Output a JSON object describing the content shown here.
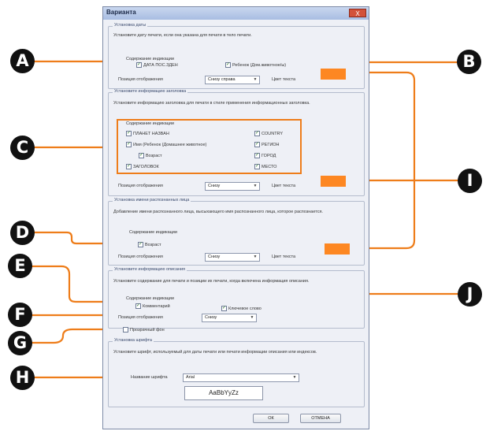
{
  "dialog": {
    "title": "Вариантa",
    "close_label": "X",
    "date_group": {
      "title": "Установка даты",
      "description": "Установите дату печати, если она указана для печати в тело печати.",
      "section_label": "Содержание индикации",
      "date_checkbox": "ДАТА ПОС.ЗДЕН",
      "date_checked": true,
      "baby_checkbox": "Ребенок (Дом.животное/ы)",
      "baby_checked": true,
      "position_label": "Позиция отображения",
      "position_value": "Снизу справа",
      "color_label": "Цвет текста"
    },
    "header_group": {
      "title": "Установите информацию заголовка",
      "description": "Установите информацию заголовка для печати в стиле применения информационных заголовка.",
      "section_label": "Содержание индикации",
      "items_left": [
        {
          "label": "ПЛАНЕТ НАЗВАН",
          "checked": true
        },
        {
          "label": "Имя (Ребенок (Домашнее животное)",
          "checked": true
        },
        {
          "label": "Возраст",
          "checked": true
        },
        {
          "label": "ЗАГОЛОВОК",
          "checked": true
        }
      ],
      "items_right": [
        {
          "label": "COUNTRY",
          "checked": true
        },
        {
          "label": "РЕГИОН",
          "checked": true
        },
        {
          "label": "ГОРОД",
          "checked": true
        },
        {
          "label": "МЕСТО",
          "checked": true
        }
      ],
      "position_label": "Позиция отображения",
      "position_value": "Снизу",
      "color_label": "Цвет текста"
    },
    "face_group": {
      "title": "Установка имени распознанных лица",
      "description": "Добавление имени распознанного лица, высыхающего имя распознанного лица, которое распознается.",
      "section_label": "Содержание индикации",
      "age_checkbox": "Возраст",
      "age_checked": true,
      "position_label": "Позиция отображения",
      "position_value": "Снизу",
      "color_label": "Цвет текста"
    },
    "caption_group": {
      "title": "Установите информацию описания",
      "description": "Установите содержание для печати и позиции их печати, когда включена информация описания.",
      "section_label": "Содержание индикации",
      "comment_checkbox": "Комментарий",
      "comment_checked": true,
      "keyword_checkbox": "Ключевое слово",
      "keyword_checked": true,
      "position_label": "Позиция отображения",
      "position_value": "Снизу"
    },
    "transparent_checkbox": "Прозрачный фон",
    "transparent_checked": false,
    "font_group": {
      "title": "Установка шрифта",
      "description": "Установите шрифт, используемый для даты печати или печати информации описания или индексов.",
      "font_label": "Название шрифта",
      "font_value": "Arial",
      "preview_text": "AaBbYyZz"
    },
    "ok_label": "ОК",
    "cancel_label": "ОТМЕНА"
  },
  "colors": {
    "accent": "#fd8722",
    "callout_line": "#ee7d1a",
    "badge": "#111111"
  },
  "callouts": {
    "A": "A",
    "B": "B",
    "C": "C",
    "D": "D",
    "E": "E",
    "F": "F",
    "G": "G",
    "H": "H",
    "I": "I",
    "J": "J"
  }
}
